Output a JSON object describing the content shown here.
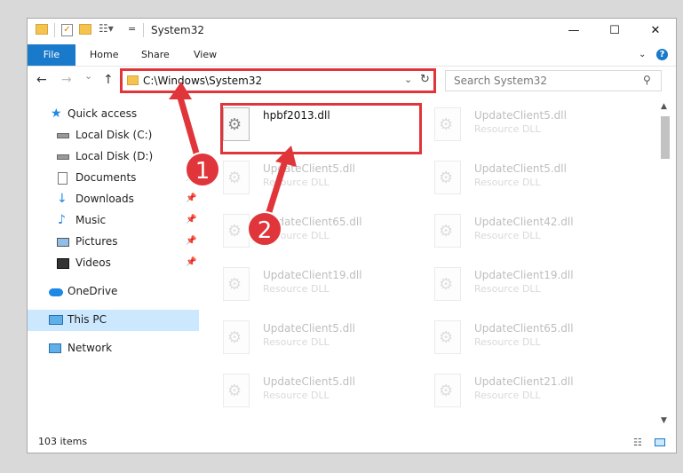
{
  "window": {
    "title": "System32",
    "minimize": "—",
    "maximize": "☐",
    "close": "✕"
  },
  "ribbon": {
    "file": "File",
    "tabs": [
      "Home",
      "Share",
      "View"
    ],
    "help": "?"
  },
  "nav": {
    "back": "←",
    "forward": "→",
    "recent": "⌄",
    "up": "↑",
    "address": "C:\\Windows\\System32",
    "refresh": "↻",
    "search_placeholder": "Search System32"
  },
  "sidebar": {
    "items": [
      {
        "label": "Quick access",
        "icon": "star-icon"
      },
      {
        "label": "Local Disk (C:)",
        "icon": "drive-icon"
      },
      {
        "label": "Local Disk (D:)",
        "icon": "drive-icon"
      },
      {
        "label": "Documents",
        "icon": "documents-icon"
      },
      {
        "label": "Downloads",
        "icon": "download-icon"
      },
      {
        "label": "Music",
        "icon": "music-icon"
      },
      {
        "label": "Pictures",
        "icon": "pictures-icon"
      },
      {
        "label": "Videos",
        "icon": "videos-icon"
      },
      {
        "label": "OneDrive",
        "icon": "cloud-icon"
      },
      {
        "label": "This PC",
        "icon": "computer-icon"
      },
      {
        "label": "Network",
        "icon": "network-icon"
      }
    ]
  },
  "files": [
    {
      "name": "hpbf2013.dll",
      "type": ""
    },
    {
      "name": "UpdateClient5.dll",
      "type": "Resource DLL"
    },
    {
      "name": "UpdateClient5.dll",
      "type": "Resource DLL"
    },
    {
      "name": "UpdateClient5.dll",
      "type": "Resource DLL"
    },
    {
      "name": "UpdateClient65.dll",
      "type": "Resource DLL"
    },
    {
      "name": "UpdateClient42.dll",
      "type": "Resource DLL"
    },
    {
      "name": "UpdateClient19.dll",
      "type": "Resource DLL"
    },
    {
      "name": "UpdateClient19.dll",
      "type": "Resource DLL"
    },
    {
      "name": "UpdateClient5.dll",
      "type": "Resource DLL"
    },
    {
      "name": "UpdateClient65.dll",
      "type": "Resource DLL"
    },
    {
      "name": "UpdateClient5.dll",
      "type": "Resource DLL"
    },
    {
      "name": "UpdateClient21.dll",
      "type": "Resource DLL"
    }
  ],
  "status": {
    "count": "103 items"
  },
  "annotations": {
    "step1": "1",
    "step2": "2",
    "color": "#e0353a"
  }
}
